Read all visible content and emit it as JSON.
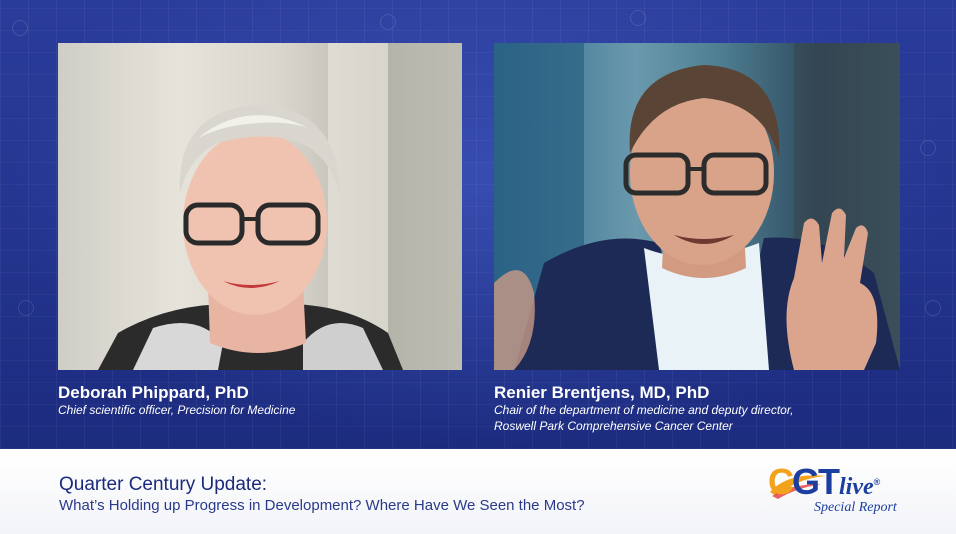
{
  "left_panel": {
    "name": "Deborah Phippard, PhD",
    "role_line1": "Chief scientific officer, Precision for Medicine"
  },
  "right_panel": {
    "name": "Renier Brentjens, MD, PhD",
    "role_line1": "Chair of the department of medicine and deputy director,",
    "role_line2": "Roswell Park Comprehensive Cancer Center"
  },
  "lower_third": {
    "title": "Quarter Century Update:",
    "subtitle": "What’s Holding up Progress in Development? Where Have We Seen the Most?"
  },
  "logo": {
    "letter_c": "C",
    "letter_g": "G",
    "letter_t": "T",
    "word_live": "live",
    "reg_mark": "®",
    "tagline": "Special Report"
  },
  "colors": {
    "background": "#23348e",
    "logo_orange": "#f2a31b",
    "logo_blue": "#1b3f9e",
    "title_text": "#1b2a7a"
  }
}
